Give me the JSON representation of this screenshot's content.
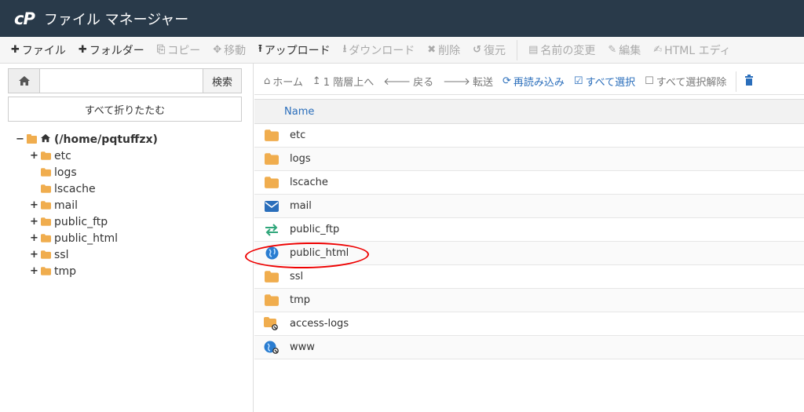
{
  "header": {
    "logo": "cP",
    "title": "ファイル マネージャー"
  },
  "toolbar": {
    "items": [
      {
        "icon": "plus-icon",
        "glyph": "✚",
        "label": "ファイル",
        "enabled": true
      },
      {
        "icon": "plus-icon",
        "glyph": "✚",
        "label": "フォルダー",
        "enabled": true
      },
      {
        "icon": "copy-icon",
        "glyph": "⎘",
        "label": "コピー",
        "enabled": false
      },
      {
        "icon": "move-icon",
        "glyph": "✥",
        "label": "移動",
        "enabled": false
      },
      {
        "icon": "upload-icon",
        "glyph": "⭱",
        "label": "アップロード",
        "enabled": true
      },
      {
        "icon": "download-icon",
        "glyph": "⭳",
        "label": "ダウンロード",
        "enabled": false
      },
      {
        "icon": "delete-icon",
        "glyph": "✖",
        "label": "削除",
        "enabled": false
      },
      {
        "icon": "restore-icon",
        "glyph": "↺",
        "label": "復元",
        "enabled": false
      },
      {
        "icon": "rename-icon",
        "glyph": "▤",
        "label": "名前の変更",
        "enabled": false
      },
      {
        "icon": "edit-icon",
        "glyph": "✎",
        "label": "編集",
        "enabled": false
      },
      {
        "icon": "html-edit-icon",
        "glyph": "✍",
        "label": "HTML エディ",
        "enabled": false
      }
    ]
  },
  "left": {
    "search": {
      "value": "",
      "placeholder": "",
      "button": "検索"
    },
    "collapse_label": "すべて折りたたむ",
    "tree": {
      "root": "(/home/pqtuffzx)",
      "items": [
        {
          "name": "etc",
          "expandable": true
        },
        {
          "name": "logs",
          "expandable": false
        },
        {
          "name": "lscache",
          "expandable": false
        },
        {
          "name": "mail",
          "expandable": true
        },
        {
          "name": "public_ftp",
          "expandable": true
        },
        {
          "name": "public_html",
          "expandable": true
        },
        {
          "name": "ssl",
          "expandable": true
        },
        {
          "name": "tmp",
          "expandable": true
        }
      ]
    }
  },
  "right": {
    "toolbar": {
      "home": "ホーム",
      "up": "1 階層上へ",
      "back": "戻る",
      "forward": "転送",
      "reload": "再読み込み",
      "select_all": "すべて選択",
      "deselect_all": "すべて選択解除"
    },
    "columns": {
      "name": "Name"
    },
    "files": [
      {
        "name": "etc",
        "icon": "folder-icon"
      },
      {
        "name": "logs",
        "icon": "folder-icon"
      },
      {
        "name": "lscache",
        "icon": "folder-icon"
      },
      {
        "name": "mail",
        "icon": "mail-icon"
      },
      {
        "name": "public_ftp",
        "icon": "transfer-icon"
      },
      {
        "name": "public_html",
        "icon": "globe-icon"
      },
      {
        "name": "ssl",
        "icon": "folder-icon"
      },
      {
        "name": "tmp",
        "icon": "folder-icon"
      },
      {
        "name": "access-logs",
        "icon": "folder-link-icon"
      },
      {
        "name": "www",
        "icon": "globe-link-icon"
      }
    ]
  },
  "colors": {
    "header_bg": "#293a4a",
    "folder": "#f0ad4e",
    "link_blue": "#2a6ebb",
    "annotation_red": "#e00000"
  }
}
